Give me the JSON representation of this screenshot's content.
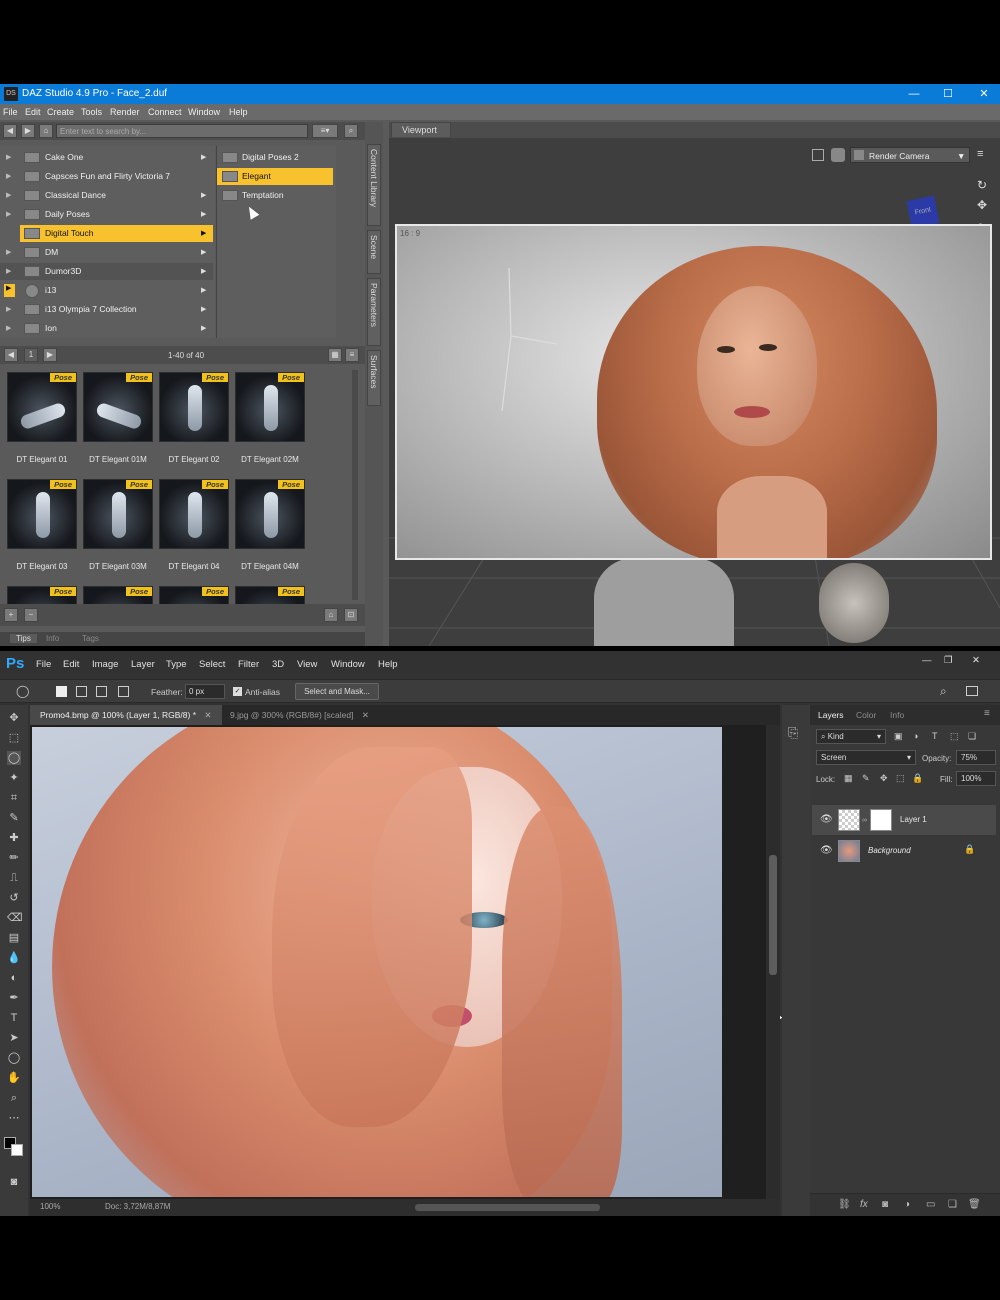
{
  "daz": {
    "title": "DAZ Studio 4.9 Pro - Face_2.duf",
    "app_icon": "DS",
    "window_buttons": [
      "—",
      "☐",
      "✕"
    ],
    "menu": [
      "File",
      "Edit",
      "Create",
      "Tools",
      "Render",
      "Connect",
      "Window",
      "Help"
    ],
    "search_placeholder": "Enter text to search by...",
    "tree": [
      {
        "label": "Cake One",
        "selected": false
      },
      {
        "label": "Capsces Fun and Flirty Victoria 7",
        "selected": false
      },
      {
        "label": "Classical Dance",
        "selected": false
      },
      {
        "label": "Daily Poses",
        "selected": false
      },
      {
        "label": "Digital Touch",
        "selected": true
      },
      {
        "label": "DM",
        "selected": false
      },
      {
        "label": "Dumor3D",
        "selected": false
      },
      {
        "label": "i13",
        "selected": false
      },
      {
        "label": "i13 Olympia 7 Collection",
        "selected": false
      },
      {
        "label": "Ion",
        "selected": false
      }
    ],
    "subtree": [
      {
        "label": "Digital Poses 2",
        "selected": false
      },
      {
        "label": "Elegant",
        "selected": true
      },
      {
        "label": "Temptation",
        "selected": false
      }
    ],
    "pager": {
      "page": "1",
      "range": "1-40 of 40"
    },
    "thumb_badge": "Pose",
    "thumbs": [
      "DT Elegant 01",
      "DT Elegant 01M",
      "DT Elegant 02",
      "DT Elegant 02M",
      "DT Elegant 03",
      "DT Elegant 03M",
      "DT Elegant 04",
      "DT Elegant 04M"
    ],
    "bottom_tabs": [
      "Tips",
      "Info",
      "Tags"
    ],
    "side_tabs": [
      "Content Library",
      "Scene",
      "Parameters",
      "Surfaces"
    ],
    "viewport": {
      "tab": "Viewport",
      "camera": "Render Camera",
      "aspect": "16 : 9",
      "cube_label": "Front"
    },
    "colors": {
      "title_bar": "#0a7bd6",
      "selection": "#f7c22e",
      "badge": "#f2c21a"
    }
  },
  "ps": {
    "logo": "Ps",
    "menu": [
      "File",
      "Edit",
      "Image",
      "Layer",
      "Type",
      "Select",
      "Filter",
      "3D",
      "View",
      "Window",
      "Help"
    ],
    "options": {
      "feather_label": "Feather:",
      "feather_value": "0 px",
      "antialias": "Anti-alias",
      "select_mask": "Select and Mask..."
    },
    "doc_tabs": [
      {
        "label": "Promo4.bmp @ 100% (Layer 1, RGB/8) *",
        "active": true
      },
      {
        "label": "9.jpg @ 300% (RGB/8#) [scaled]",
        "active": false
      }
    ],
    "status": {
      "zoom": "100%",
      "doc": "Doc: 3,72M/8,87M"
    },
    "layers_panel": {
      "tabs": [
        "Layers",
        "Color",
        "Info"
      ],
      "kind": "Kind",
      "blend_mode": "Screen",
      "opacity_label": "Opacity:",
      "opacity": "75%",
      "lock_label": "Lock:",
      "fill_label": "Fill:",
      "fill": "100%",
      "layers": [
        {
          "name": "Layer 1",
          "selected": true
        },
        {
          "name": "Background",
          "selected": false
        }
      ],
      "footer_icons": [
        "link-icon",
        "fx-icon",
        "mask-icon",
        "adjustment-icon",
        "folder-icon",
        "new-layer-icon",
        "trash-icon"
      ]
    },
    "colors": {
      "logo": "#30a8ff",
      "background": "#323232"
    }
  }
}
